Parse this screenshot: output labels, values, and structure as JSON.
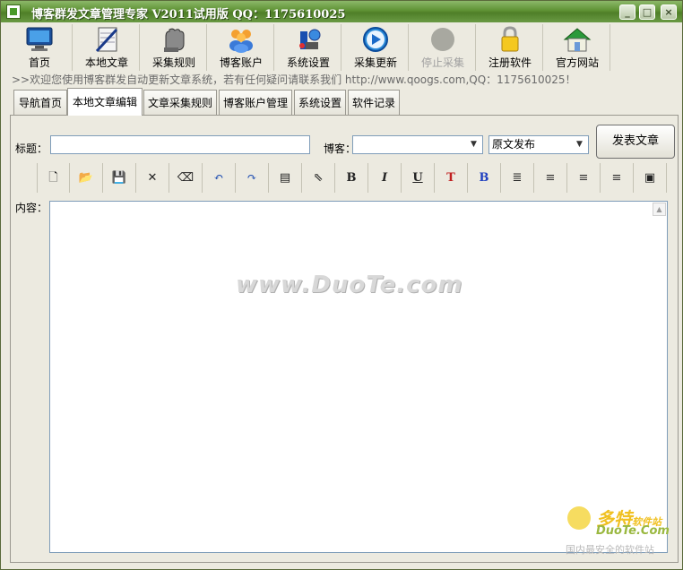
{
  "window": {
    "title": "博客群发文章管理专家 V2011试用版  QQ：1175610025"
  },
  "toolbar": [
    {
      "label": "首页",
      "icon": "monitor-icon"
    },
    {
      "label": "本地文章",
      "icon": "notebook-icon"
    },
    {
      "label": "采集规则",
      "icon": "glove-icon"
    },
    {
      "label": "博客账户",
      "icon": "users-icon"
    },
    {
      "label": "系统设置",
      "icon": "tools-icon"
    },
    {
      "label": "采集更新",
      "icon": "play-icon"
    },
    {
      "label": "停止采集",
      "icon": "stop-icon",
      "disabled": true
    },
    {
      "label": "注册软件",
      "icon": "lock-icon"
    },
    {
      "label": "官方网站",
      "icon": "home-icon"
    }
  ],
  "marquee": ">>欢迎您使用博客群发自动更新文章系统，若有任何疑问请联系我们 http://www.qoogs.com,QQ：1175610025！",
  "tabs": [
    "导航首页",
    "本地文章编辑",
    "文章采集规则",
    "博客账户管理",
    "系统设置",
    "软件记录"
  ],
  "active_tab": "本地文章编辑",
  "form": {
    "title_label": "标题：",
    "title_value": "",
    "blog_label": "博客：",
    "blog_value": "",
    "mode_value": "原文发布",
    "publish_label": "发表文章",
    "content_label": "内容："
  },
  "editor_toolbar": [
    {
      "name": "new-icon",
      "glyph": "🗋"
    },
    {
      "name": "open-icon",
      "glyph": "📂"
    },
    {
      "name": "save-icon",
      "glyph": "💾"
    },
    {
      "name": "delete-icon",
      "glyph": "✕"
    },
    {
      "name": "eraser-icon",
      "glyph": "⌫"
    },
    {
      "name": "undo-icon",
      "glyph": "↶"
    },
    {
      "name": "redo-icon",
      "glyph": "↷"
    },
    {
      "name": "select-all-icon",
      "glyph": "▤"
    },
    {
      "name": "pointer-icon",
      "glyph": "⇖"
    },
    {
      "name": "bold-icon",
      "glyph": "B"
    },
    {
      "name": "italic-icon",
      "glyph": "I"
    },
    {
      "name": "underline-icon",
      "glyph": "U"
    },
    {
      "name": "font-color-icon",
      "glyph": "T"
    },
    {
      "name": "bg-color-icon",
      "glyph": "B"
    },
    {
      "name": "justify-icon",
      "glyph": "≣"
    },
    {
      "name": "align-left-icon",
      "glyph": "≡"
    },
    {
      "name": "align-center-icon",
      "glyph": "≡"
    },
    {
      "name": "align-right-icon",
      "glyph": "≡"
    },
    {
      "name": "insert-image-icon",
      "glyph": "▣"
    }
  ],
  "watermark": "www.DuoTe.com",
  "corner_logo": {
    "line1": "多特",
    "line1b": "软件站",
    "line2": "DuoTe.Com",
    "line3": "国内最安全的软件站"
  }
}
